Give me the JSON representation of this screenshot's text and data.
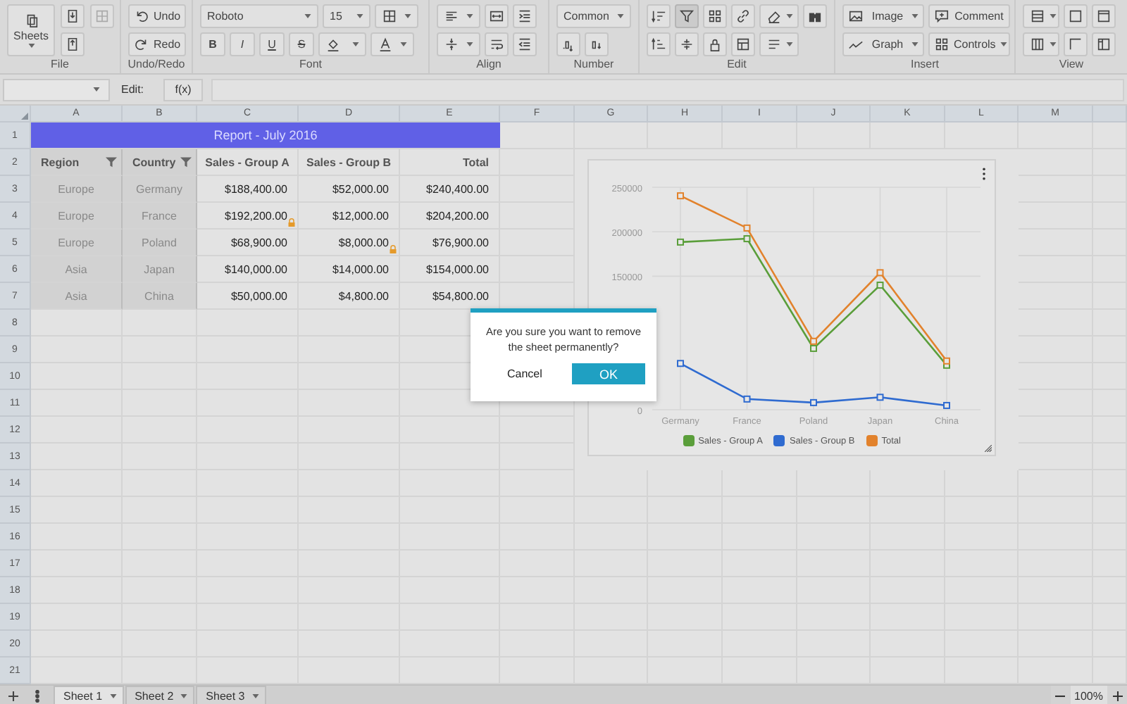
{
  "toolbar": {
    "sheets_button": "Sheets",
    "undo": "Undo",
    "redo": "Redo",
    "font_family": "Roboto",
    "font_size": "15",
    "style_buttons": [
      "B",
      "I",
      "U",
      "S"
    ],
    "number_format": "Common",
    "filter_selected": true,
    "insert_buttons": [
      {
        "label": "Image",
        "dropdown": true
      },
      {
        "label": "Comment",
        "dropdown": false
      },
      {
        "label": "Graph",
        "dropdown": true
      },
      {
        "label": "Controls",
        "dropdown": true
      }
    ],
    "group_labels": [
      "File",
      "Undo/Redo",
      "Font",
      "Align",
      "Number",
      "Edit",
      "Insert",
      "View"
    ]
  },
  "formula_bar": {
    "label": "Edit:",
    "function_button": "f(x)"
  },
  "columns": [
    "A",
    "B",
    "C",
    "D",
    "E",
    "F",
    "G",
    "H",
    "I",
    "J",
    "K",
    "L",
    "M"
  ],
  "rows": [
    "1",
    "2",
    "3",
    "4",
    "5",
    "6",
    "7",
    "8",
    "9",
    "10",
    "11",
    "12",
    "13",
    "14",
    "15",
    "16",
    "17",
    "18",
    "19",
    "20",
    "21"
  ],
  "report": {
    "title": "Report - July 2016",
    "header": [
      {
        "text": "Region",
        "filter": true
      },
      {
        "text": "Country",
        "filter": true
      },
      {
        "text": "Sales - Group A",
        "filter": false
      },
      {
        "text": "Sales - Group B",
        "filter": false
      },
      {
        "text": "Total",
        "filter": false
      }
    ],
    "rows": [
      {
        "cells": [
          {
            "text": "Europe",
            "locked": false
          },
          {
            "text": "Germany",
            "locked": false
          },
          {
            "text": "$188,400.00",
            "locked": false
          },
          {
            "text": "$52,000.00",
            "locked": false
          },
          {
            "text": "$240,400.00",
            "locked": false
          }
        ]
      },
      {
        "cells": [
          {
            "text": "Europe",
            "locked": false
          },
          {
            "text": "France",
            "locked": false
          },
          {
            "text": "$192,200.00",
            "locked": true
          },
          {
            "text": "$12,000.00",
            "locked": false
          },
          {
            "text": "$204,200.00",
            "locked": false
          }
        ]
      },
      {
        "cells": [
          {
            "text": "Europe",
            "locked": false
          },
          {
            "text": "Poland",
            "locked": false
          },
          {
            "text": "$68,900.00",
            "locked": false
          },
          {
            "text": "$8,000.00",
            "locked": true
          },
          {
            "text": "$76,900.00",
            "locked": false
          }
        ]
      },
      {
        "cells": [
          {
            "text": "Asia",
            "locked": false
          },
          {
            "text": "Japan",
            "locked": false
          },
          {
            "text": "$140,000.00",
            "locked": false
          },
          {
            "text": "$14,000.00",
            "locked": false
          },
          {
            "text": "$154,000.00",
            "locked": false
          }
        ]
      },
      {
        "cells": [
          {
            "text": "Asia",
            "locked": false
          },
          {
            "text": "China",
            "locked": false
          },
          {
            "text": "$50,000.00",
            "locked": false
          },
          {
            "text": "$4,800.00",
            "locked": false
          },
          {
            "text": "$54,800.00",
            "locked": false
          }
        ]
      }
    ]
  },
  "chart": {
    "chart_data": {
      "type": "line",
      "categories": [
        "Germany",
        "France",
        "Poland",
        "Japan",
        "China"
      ],
      "grid": true,
      "series": [
        {
          "name": "Sales - Group A",
          "color": "#5a9e3a",
          "marker": "square",
          "values": [
            188400,
            192200,
            68900,
            140000,
            50000
          ]
        },
        {
          "name": "Sales - Group B",
          "color": "#2f6bd0",
          "marker": "square",
          "values": [
            52000,
            12000,
            8000,
            14000,
            4800
          ]
        },
        {
          "name": "Total",
          "color": "#e2822c",
          "marker": "square",
          "values": [
            240400,
            204200,
            76900,
            154000,
            54800
          ]
        }
      ],
      "ylim": [
        0,
        250000
      ],
      "yticks": [
        0,
        150000,
        200000,
        250000
      ]
    }
  },
  "dialog": {
    "message": "Are you sure you want to remove the sheet permanently?",
    "buttons": [
      {
        "label": "Cancel",
        "kind": "text"
      },
      {
        "label": "OK",
        "kind": "primary"
      }
    ]
  },
  "sheet_tabs": [
    {
      "label": "Sheet 1",
      "selected": true
    },
    {
      "label": "Sheet 2",
      "selected": false
    },
    {
      "label": "Sheet 3",
      "selected": false
    }
  ],
  "zoom": "100%"
}
